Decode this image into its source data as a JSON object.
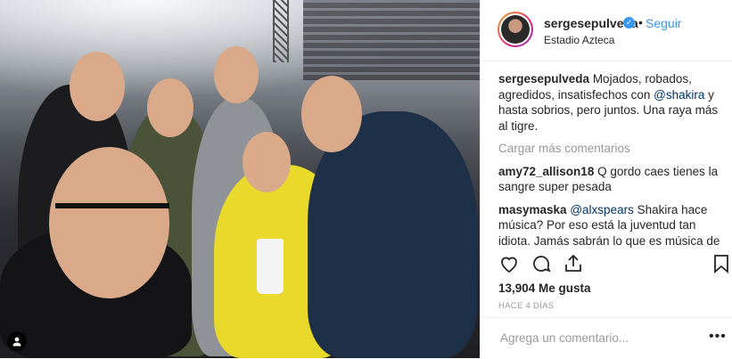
{
  "post": {
    "username": "sergesepulveda",
    "follow_label": "Seguir",
    "separator": "•",
    "location": "Estadio Azteca",
    "verified_icon": "verified-badge-icon"
  },
  "comments": {
    "caption_user": "sergesepulveda",
    "caption_text_1": " Mojados, robados, agredidos, insatisfechos con ",
    "caption_mention": "@shakira",
    "caption_text_2": " y hasta sobrios, pero juntos. Una raya más al tigre.",
    "load_more": "Cargar más comentarios",
    "items": [
      {
        "user": "amy72_allison18",
        "text": " Q gordo caes tienes la sangre super pesada"
      },
      {
        "user": "masymaska",
        "mention": "@alxspears",
        "text": " Shakira hace música? Por eso está la juventud tan idiota. Jamás sabrán lo que es música de verdad, ejemplos: Bob Dylan, Joaquín Sabina, AC"
      }
    ]
  },
  "actions": {
    "like_icon": "heart-icon",
    "comment_icon": "comment-icon",
    "share_icon": "share-icon",
    "save_icon": "bookmark-icon"
  },
  "likes_text": "13,904 Me gusta",
  "time_ago": "HACE 4 DÍAS",
  "add_comment": {
    "placeholder": "Agrega un comentario...",
    "more_icon": "more-options-icon",
    "more_label": "•••"
  },
  "colors": {
    "accent": "#3897f0",
    "muted": "#999999",
    "border": "#efefef",
    "text": "#262626"
  }
}
